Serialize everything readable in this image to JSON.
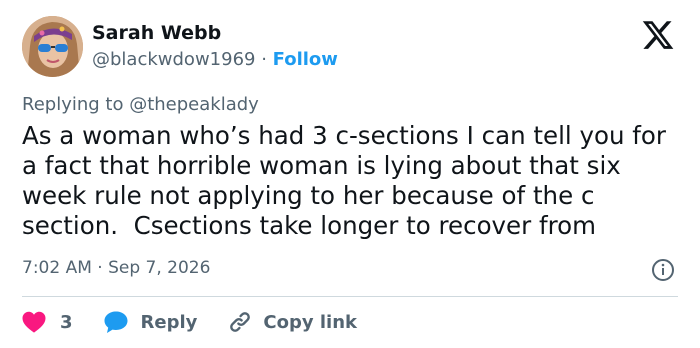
{
  "author": {
    "name": "Sarah Webb",
    "handle": "@blackwdow1969",
    "separator": " · ",
    "follow_label": "Follow"
  },
  "reply": {
    "prefix": "Replying to ",
    "mention": "@thepeaklady"
  },
  "tweet": {
    "text": "As a woman who’s had 3 c-sections I can tell you for a fact that horrible woman is lying about that six week rule not applying to her because of the c section.  Csections take longer to recover from"
  },
  "meta": {
    "time": "7:02 AM",
    "separator": " · ",
    "date": "Sep 7, 2026"
  },
  "actions": {
    "like_count": "3",
    "reply_label": "Reply",
    "copy_label": "Copy link"
  },
  "colors": {
    "like": "#f91880",
    "reply": "#1d9bf0",
    "link": "#1d9bf0",
    "muted": "#536471"
  },
  "icons": [
    "x-logo-icon",
    "heart-icon",
    "reply-bubble-icon",
    "link-icon",
    "info-icon"
  ]
}
